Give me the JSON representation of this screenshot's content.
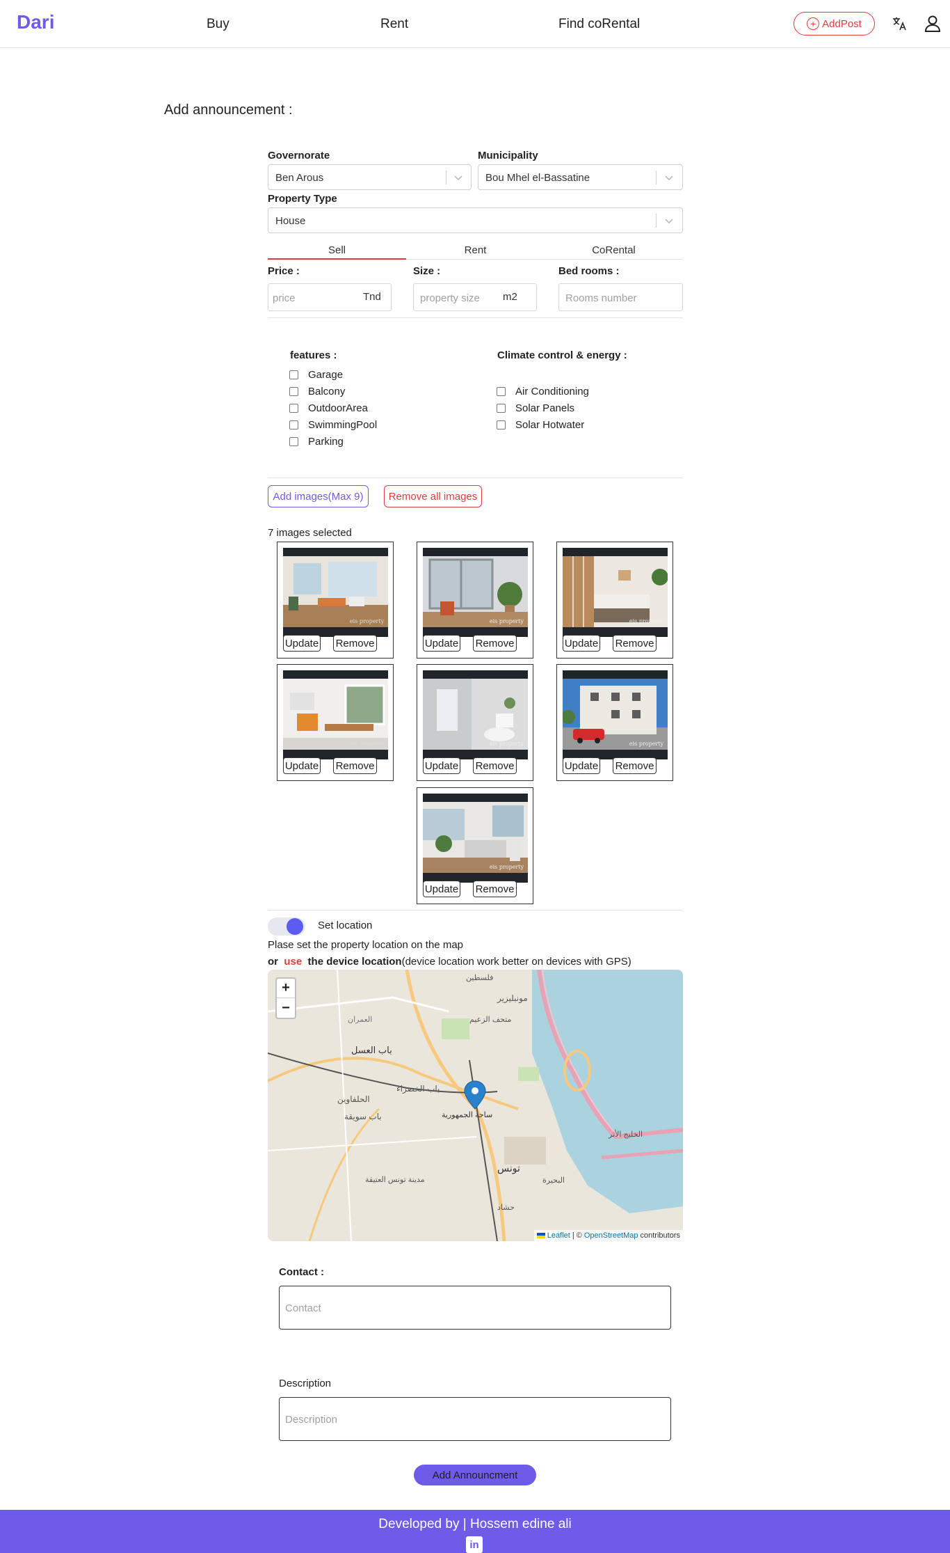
{
  "navbar": {
    "brand": "Dari",
    "links": [
      "Buy",
      "Rent",
      "Find coRental"
    ],
    "addpost_label": "AddPost"
  },
  "page": {
    "title": "Add announcement :"
  },
  "location": {
    "governorate_label": "Governorate",
    "governorate_value": "Ben Arous",
    "municipality_label": "Municipality",
    "municipality_value": "Bou Mhel el-Bassatine"
  },
  "property": {
    "type_label": "Property Type",
    "type_value": "House"
  },
  "tabs": [
    "Sell",
    "Rent",
    "CoRental"
  ],
  "fields": {
    "price_label": "Price :",
    "price_placeholder": "price",
    "price_unit": "Tnd",
    "size_label": "Size :",
    "size_placeholder": "property size",
    "size_unit": "m2",
    "bedrooms_label": "Bed rooms :",
    "bedrooms_placeholder": "Rooms number"
  },
  "features": {
    "title": "features :",
    "items": [
      "Garage",
      "Balcony",
      "OutdoorArea",
      "SwimmingPool",
      "Parking"
    ]
  },
  "climate": {
    "title": "Climate control & energy :",
    "items": [
      "Air Conditioning",
      "Solar Panels",
      "Solar Hotwater"
    ]
  },
  "images": {
    "add_label": "Add images(Max 9)",
    "remove_all_label": "Remove all images",
    "count_text": "7 images selected",
    "update_label": "Update",
    "remove_label": "Remove",
    "watermark": "eis property"
  },
  "map_section": {
    "toggle_label": "Set location",
    "hint": "Plase set the property location on the map",
    "or": "or",
    "use": "use",
    "device_location": "the device location",
    "device_note": "(device location work better on devices with GPS)",
    "zoom_in": "+",
    "zoom_out": "−",
    "attribution_leaflet": "Leaflet",
    "attribution_sep": "| ©",
    "attribution_osm": "OpenStreetMap",
    "attribution_tail": "contributors",
    "place_labels": [
      "باب العسل",
      "الحلفاوين",
      "باب الخضراء",
      "ساحة الجمهورية",
      "تونس",
      "مدينة تونس العتيقة",
      "مونبليزير",
      "العمران",
      "باب سويقة",
      "البحيرة",
      "فلسطين",
      "الخليج الأثر",
      "متحف الزعيم",
      "حشاد"
    ]
  },
  "contact": {
    "label": "Contact :",
    "placeholder": "Contact"
  },
  "description": {
    "label": "Description",
    "placeholder": "Description"
  },
  "submit_label": "Add Announcment",
  "footer": {
    "text": "Developed by | Hossem edine ali",
    "linkedin": "in"
  },
  "colors": {
    "brand": "#6c5ce7",
    "danger": "#e23b3b"
  }
}
